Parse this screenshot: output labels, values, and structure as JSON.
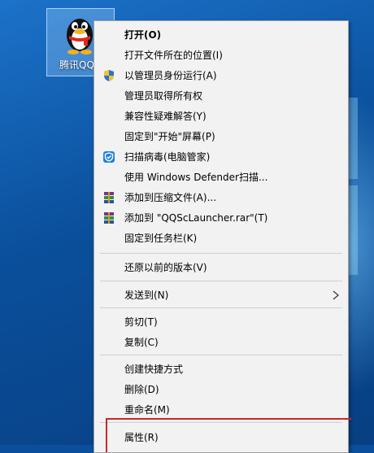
{
  "desktop": {
    "icon_label": "腾讯QQ",
    "icon_name": "qq-penguin-icon"
  },
  "context_menu": {
    "items": [
      {
        "label": "打开(O)",
        "icon": null
      },
      {
        "label": "打开文件所在的位置(I)",
        "icon": null
      },
      {
        "label": "以管理员身份运行(A)",
        "icon": "uac-shield-icon"
      },
      {
        "label": "管理员取得所有权",
        "icon": null
      },
      {
        "label": "兼容性疑难解答(Y)",
        "icon": null
      },
      {
        "label": "固定到\"开始\"屏幕(P)",
        "icon": null
      },
      {
        "label": "扫描病毒(电脑管家)",
        "icon": "tencent-pc-manager-icon"
      },
      {
        "label": "使用 Windows Defender扫描...",
        "icon": null
      },
      {
        "label": "添加到压缩文件(A)...",
        "icon": "winrar-icon"
      },
      {
        "label": "添加到 \"QQScLauncher.rar\"(T)",
        "icon": "winrar-icon"
      },
      {
        "label": "固定到任务栏(K)",
        "icon": null
      },
      {
        "label": "还原以前的版本(V)",
        "icon": null
      },
      {
        "label": "发送到(N)",
        "icon": "chevron-right-icon"
      },
      {
        "label": "剪切(T)",
        "icon": null
      },
      {
        "label": "复制(C)",
        "icon": null
      },
      {
        "label": "创建快捷方式",
        "icon": null
      },
      {
        "label": "删除(D)",
        "icon": null
      },
      {
        "label": "重命名(M)",
        "icon": null
      },
      {
        "label": "属性(R)",
        "icon": null
      }
    ]
  },
  "colors": {
    "highlight_border": "#c6282b",
    "menu_background": "#f2f2f2"
  }
}
